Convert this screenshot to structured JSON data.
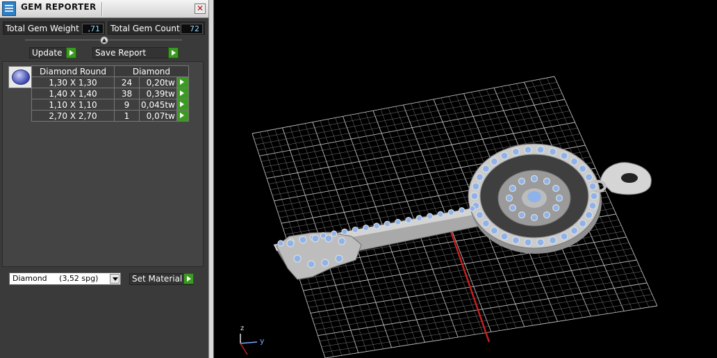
{
  "window": {
    "title": "GEM REPORTER",
    "close_symbol": "✕"
  },
  "stats": {
    "total_weight_label": "Total Gem Weight",
    "total_weight_value": ",71",
    "total_count_label": "Total Gem Count",
    "total_count_value": "72"
  },
  "toolbar": {
    "update_label": "Update",
    "save_report_label": "Save Report"
  },
  "table": {
    "columns": [
      "Diamond Round",
      "Diamond"
    ],
    "rows": [
      {
        "size": "1,30 X 1,30",
        "count": "24",
        "weight": "0,20tw"
      },
      {
        "size": "1,40 X 1,40",
        "count": "38",
        "weight": "0,39tw"
      },
      {
        "size": "1,10 X 1,10",
        "count": "9",
        "weight": "0,045tw"
      },
      {
        "size": "2,70 X 2,70",
        "count": "1",
        "weight": "0,07tw"
      }
    ]
  },
  "material": {
    "selected": "Diamond     (3,52 spg)",
    "set_label": "Set Material"
  },
  "viewport": {
    "axis_z": "z",
    "axis_y": "y",
    "gem_color": "#8fb3e8",
    "metal_color": "#c8c8c8",
    "grid_color": "#8a8a8a"
  },
  "colors": {
    "accent_green": "#3b9b20",
    "value_text": "#8fd9ff"
  }
}
